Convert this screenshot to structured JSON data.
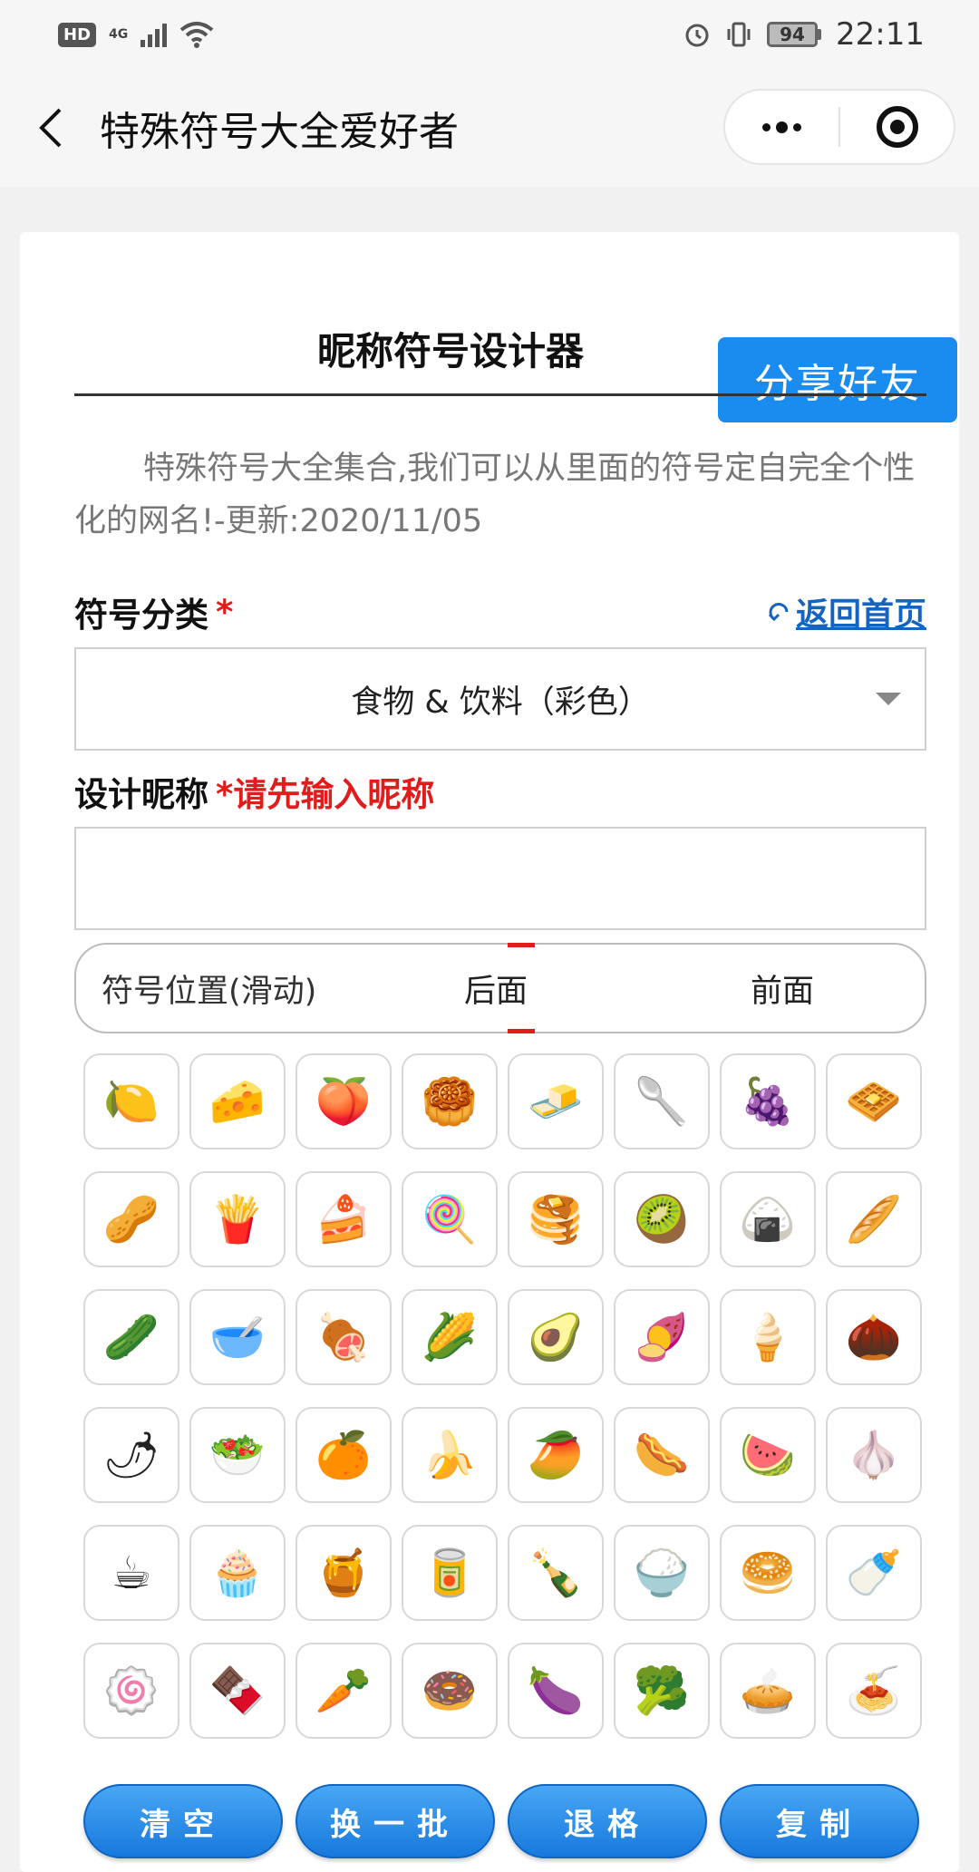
{
  "status_bar": {
    "hd": "HD",
    "network": "4G",
    "battery": "94",
    "time": "22:11"
  },
  "nav": {
    "title": "特殊符号大全爱好者"
  },
  "header": {
    "title": "昵称符号设计器",
    "share_label": "分享好友"
  },
  "intro": "特殊符号大全集合,我们可以从里面的符号定自完全个性化的网名!-更新:2020/11/05",
  "category": {
    "label": "符号分类",
    "required_mark": "*",
    "home_link": "返回首页",
    "selected": "食物 & 饮料（彩色）"
  },
  "nickname": {
    "label": "设计昵称",
    "hint": "*请先输入昵称",
    "value": ""
  },
  "position": {
    "label": "符号位置(滑动)",
    "option_after": "后面",
    "option_before": "前面",
    "selected": "后面"
  },
  "symbols": [
    "🍋",
    "🧀",
    "🍑",
    "🥮",
    "🧈",
    "🥄",
    "🍇",
    "🧇",
    "🥜",
    "🍟",
    "🍰",
    "🍭",
    "🥞",
    "🥝",
    "🍙",
    "🥖",
    "🥒",
    "🥣",
    "🍖",
    "🌽",
    "🥑",
    "🍠",
    "🍦",
    "🌰",
    "🌶",
    "🥗",
    "🍊",
    "🍌",
    "🥭",
    "🌭",
    "🍉",
    "🧄",
    "☕",
    "🧁",
    "🍯",
    "🥫",
    "🍾",
    "🍚",
    "🥯",
    "🍼",
    "🍥",
    "🍫",
    "🥕",
    "🍩",
    "🍆",
    "🥦",
    "🥧",
    "🍝"
  ],
  "actions": {
    "clear": "清空",
    "next_batch": "换一批",
    "backspace": "退格",
    "copy": "复制"
  },
  "colors": {
    "accent": "#1a8cf0",
    "required": "#e21b1b",
    "link": "#1565c0"
  }
}
